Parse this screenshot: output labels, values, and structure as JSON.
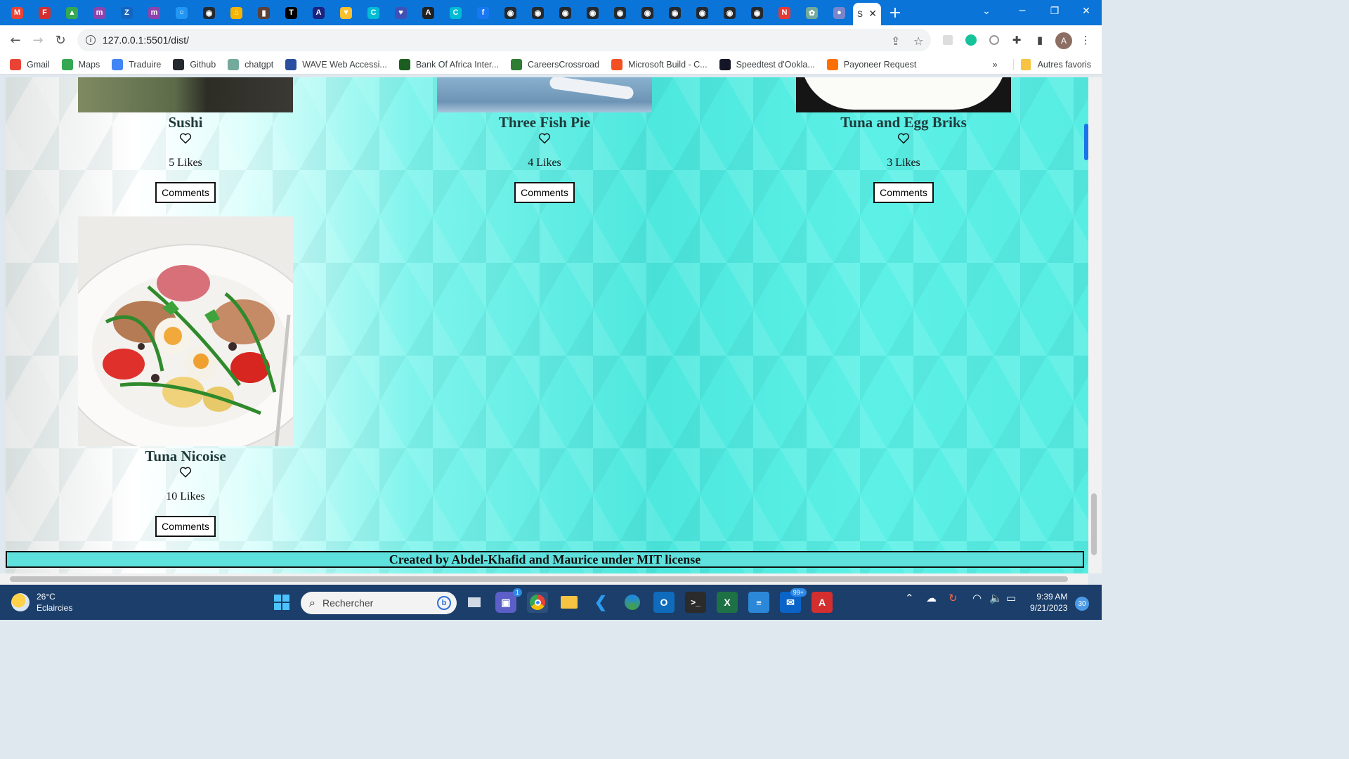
{
  "browser": {
    "tabs": [
      {
        "icon": "gmail-icon",
        "color": "#ea4335",
        "glyph": "M"
      },
      {
        "icon": "app-icon",
        "color": "#d32f2f",
        "glyph": "F"
      },
      {
        "icon": "drive-icon",
        "color": "#34a853",
        "glyph": "▲"
      },
      {
        "icon": "app-icon",
        "color": "#8e44ad",
        "glyph": "m"
      },
      {
        "icon": "app-icon",
        "color": "#1565c0",
        "glyph": "Z"
      },
      {
        "icon": "app-icon",
        "color": "#8e44ad",
        "glyph": "m"
      },
      {
        "icon": "app-icon",
        "color": "#2196f3",
        "glyph": "○"
      },
      {
        "icon": "github-icon",
        "color": "#24292f",
        "glyph": "◉"
      },
      {
        "icon": "app-icon",
        "color": "#f4b400",
        "glyph": "⌂"
      },
      {
        "icon": "app-icon",
        "color": "#5d4037",
        "glyph": "▮"
      },
      {
        "icon": "app-icon",
        "color": "#000000",
        "glyph": "T"
      },
      {
        "icon": "app-icon",
        "color": "#1a237e",
        "glyph": "A"
      },
      {
        "icon": "app-icon",
        "color": "#fbc02d",
        "glyph": "▼"
      },
      {
        "icon": "app-icon",
        "color": "#00bcd4",
        "glyph": "C"
      },
      {
        "icon": "heart-app-icon",
        "color": "#3f51b5",
        "glyph": "♥"
      },
      {
        "icon": "app-icon",
        "color": "#212121",
        "glyph": "A"
      },
      {
        "icon": "app-icon",
        "color": "#00bcd4",
        "glyph": "C"
      },
      {
        "icon": "facebook-icon",
        "color": "#1877f2",
        "glyph": "f"
      },
      {
        "icon": "github-icon",
        "color": "#24292f",
        "glyph": "◉"
      },
      {
        "icon": "github-icon",
        "color": "#24292f",
        "glyph": "◉"
      },
      {
        "icon": "github-icon",
        "color": "#24292f",
        "glyph": "◉"
      },
      {
        "icon": "github-icon",
        "color": "#24292f",
        "glyph": "◉"
      },
      {
        "icon": "github-icon",
        "color": "#24292f",
        "glyph": "◉"
      },
      {
        "icon": "github-icon",
        "color": "#24292f",
        "glyph": "◉"
      },
      {
        "icon": "github-icon",
        "color": "#24292f",
        "glyph": "◉"
      },
      {
        "icon": "github-icon",
        "color": "#24292f",
        "glyph": "◉"
      },
      {
        "icon": "github-icon",
        "color": "#24292f",
        "glyph": "◉"
      },
      {
        "icon": "github-icon",
        "color": "#24292f",
        "glyph": "◉"
      },
      {
        "icon": "app-icon",
        "color": "#e53935",
        "glyph": "N"
      },
      {
        "icon": "chatgpt-icon",
        "color": "#74aa9c",
        "glyph": "✿"
      },
      {
        "icon": "app-icon",
        "color": "#7986cb",
        "glyph": "●"
      }
    ],
    "active_tab_title": "S",
    "url": "127.0.0.1:5501/dist/",
    "bookmarks": [
      {
        "label": "Gmail",
        "color": "#ea4335"
      },
      {
        "label": "Maps",
        "color": "#34a853"
      },
      {
        "label": "Traduire",
        "color": "#4285f4"
      },
      {
        "label": "Github",
        "color": "#24292f"
      },
      {
        "label": "chatgpt",
        "color": "#74aa9c"
      },
      {
        "label": "WAVE Web Accessi...",
        "color": "#2b4fa0"
      },
      {
        "label": "Bank Of Africa Inter...",
        "color": "#1b5e20"
      },
      {
        "label": "CareersCrossroad",
        "color": "#2e7d32"
      },
      {
        "label": "Microsoft Build - C...",
        "color": "#f25022"
      },
      {
        "label": "Speedtest d'Ookla...",
        "color": "#141526"
      },
      {
        "label": "Payoneer Request",
        "color": "#ff6f00"
      }
    ],
    "bookmarks_more": "»",
    "other_bookmarks": "Autres favoris",
    "profile_initial": "A"
  },
  "page": {
    "cards": [
      {
        "name": "Sushi",
        "likes": "5 Likes",
        "comments": "Comments",
        "image_tone": "#5a6b4a"
      },
      {
        "name": "Three Fish Pie",
        "likes": "4 Likes",
        "comments": "Comments",
        "image_tone": "#6e94b5"
      },
      {
        "name": "Tuna and Egg Briks",
        "likes": "3 Likes",
        "comments": "Comments",
        "image_tone": "#1a1a1a"
      },
      {
        "name": "Tuna Nicoise",
        "likes": "10 Likes",
        "comments": "Comments",
        "image_tone": "#f0eeeb"
      }
    ],
    "footer": "Created by Abdel-Khafid and Maurice under MIT license"
  },
  "taskbar": {
    "weather_temp": "26°C",
    "weather_desc": "Eclaircies",
    "search_placeholder": "Rechercher",
    "mail_badge": "99+",
    "teams_badge": "1",
    "time": "9:39 AM",
    "date": "9/21/2023",
    "notifications": "30"
  }
}
